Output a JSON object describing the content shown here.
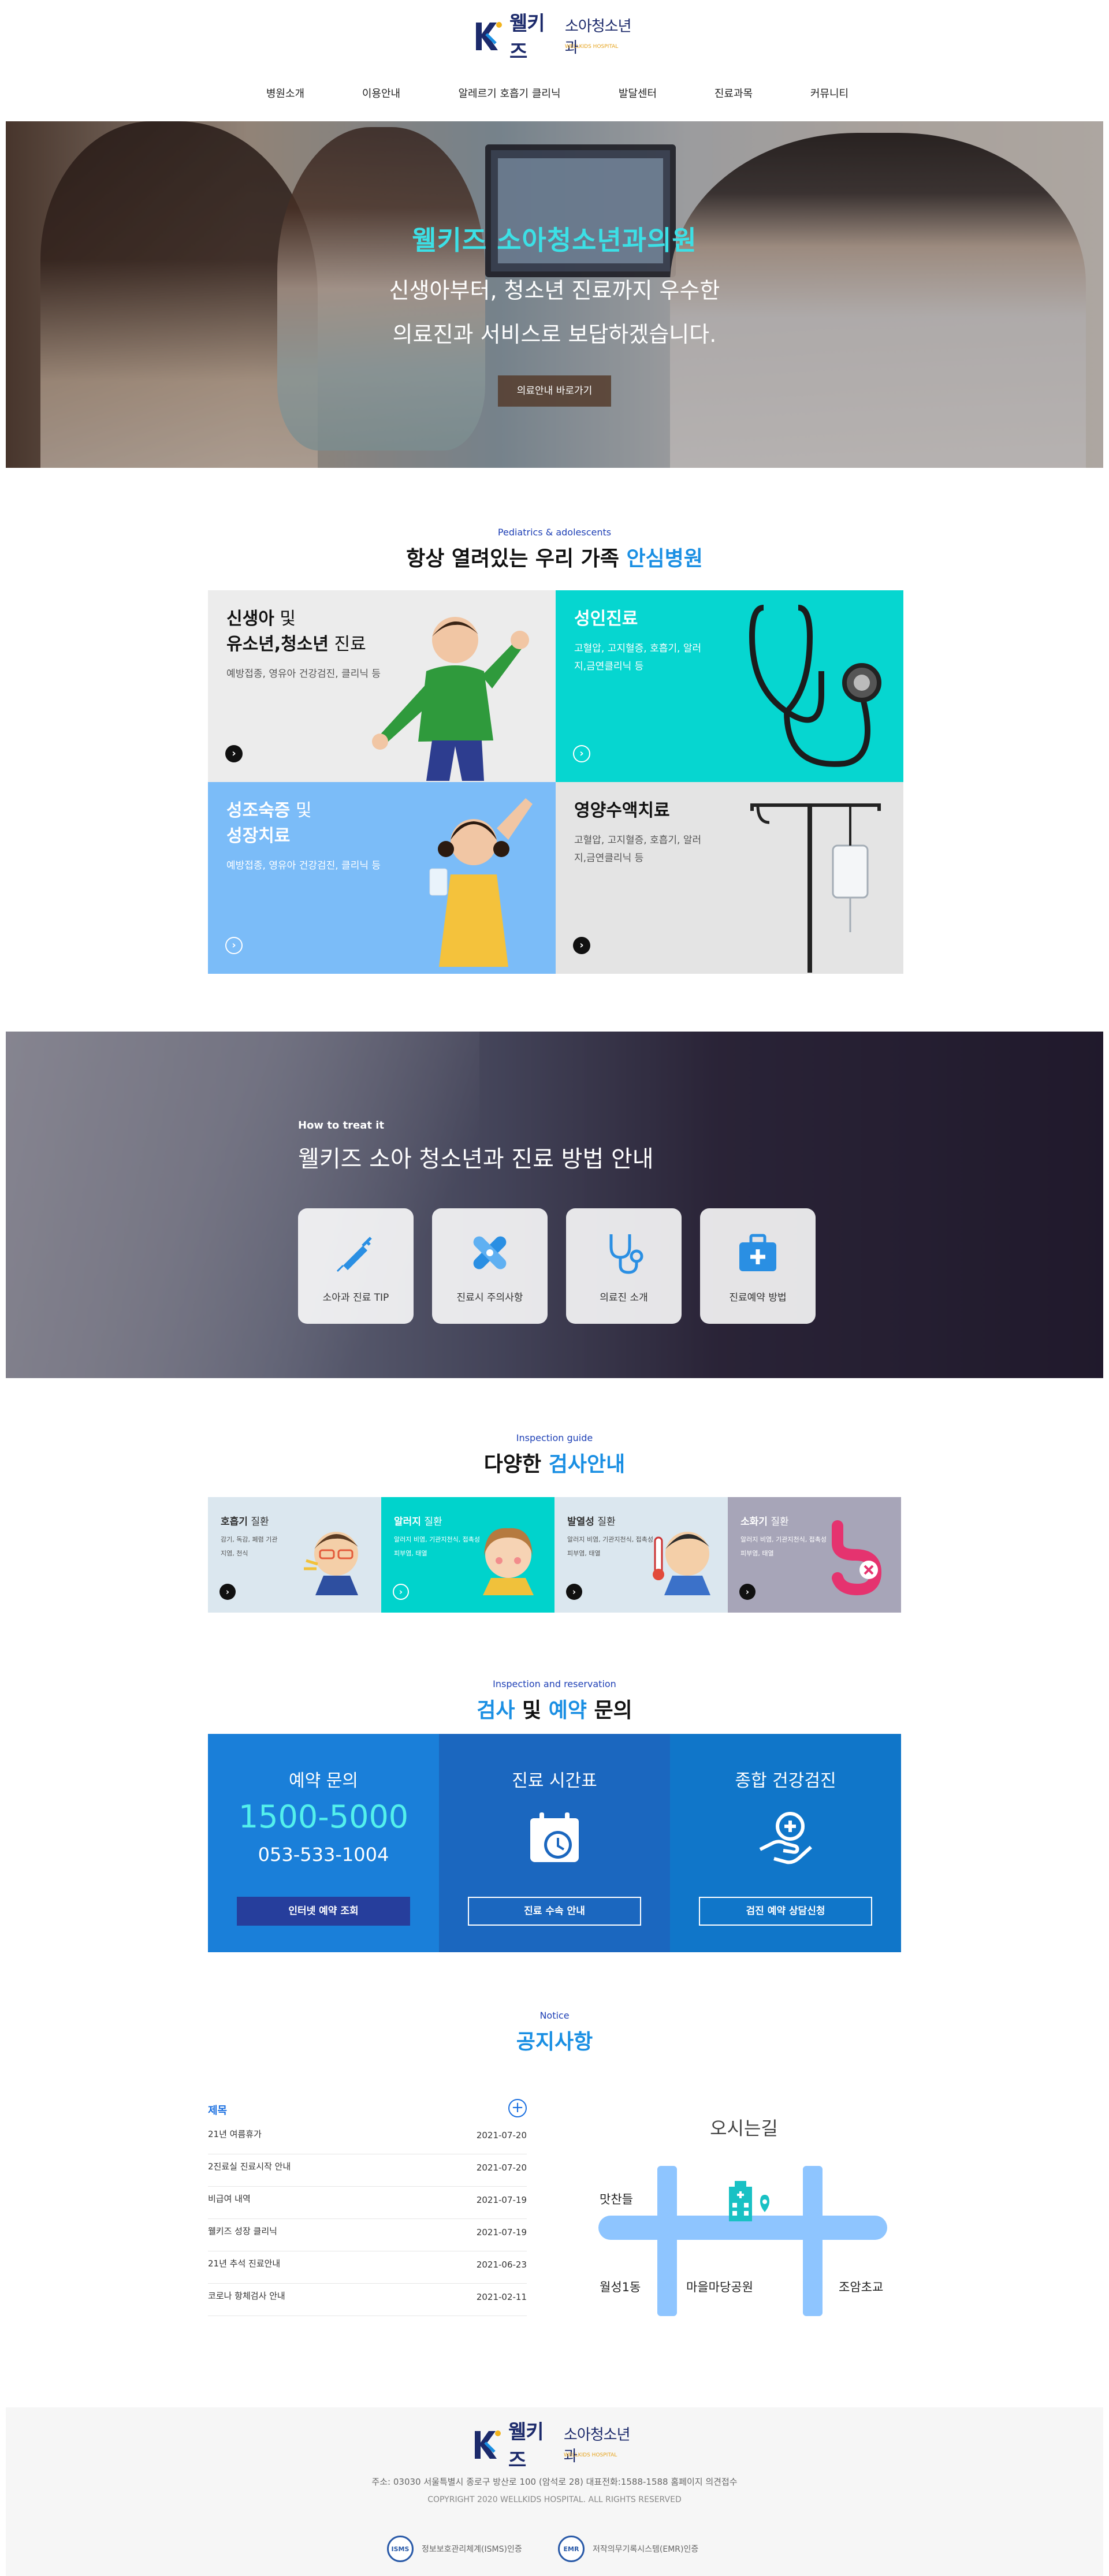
{
  "brand": {
    "name": "웰키즈",
    "subtitle": "소아청소년과",
    "tagline": "WELLKIDS HOSPITAL",
    "accent": "#1a8fe3",
    "navy": "#1c2a6b"
  },
  "nav": {
    "items": [
      {
        "label": "병원소개"
      },
      {
        "label": "이용안내"
      },
      {
        "label": "알레르기 호흡기 클리닉"
      },
      {
        "label": "발달센터"
      },
      {
        "label": "진료과목"
      },
      {
        "label": "커뮤니티"
      }
    ]
  },
  "hero": {
    "title": "웰키즈 소아청소년과의원",
    "line1": "신생아부터, 청소년 진료까지 우수한",
    "line2": "의료진과 서비스로 보답하겠습니다.",
    "button": "의료안내 바로가기"
  },
  "services_section": {
    "sub": "Pediatrics & adolescents",
    "title_main": "항상 열려있는 우리 가족",
    "title_hl": "안심병원"
  },
  "services": [
    {
      "title_a": "신생아",
      "title_b": " 및",
      "title_c": "유소년,청소년",
      "title_d": " 진료",
      "desc": "예방접종, 영유아 건강검진, 클리닉 등",
      "arrow": "›"
    },
    {
      "title_a": "성인진료",
      "desc": "고혈압, 고지혈증, 호흡기, 알러지,금연클리닉 등",
      "arrow": "›"
    },
    {
      "title_a": "성조숙증",
      "title_b": " 및",
      "title_c": "성장치료",
      "desc": "예방접종, 영유아 건강검진, 클리닉 등",
      "arrow": "›"
    },
    {
      "title_a": "영양수액치료",
      "desc": "고혈압, 고지혈증, 호흡기, 알러지,금연클리닉 등",
      "arrow": "›"
    }
  ],
  "howto": {
    "sub": "How to treat it",
    "title": "웰키즈 소아 청소년과 진료 방법 안내",
    "cards": [
      {
        "label": "소아과 진료 TIP",
        "icon": "syringe-icon"
      },
      {
        "label": "진료시 주의사항",
        "icon": "bandage-icon"
      },
      {
        "label": "의료진 소개",
        "icon": "stethoscope-icon"
      },
      {
        "label": "진료예약 방법",
        "icon": "medical-bag-icon"
      }
    ]
  },
  "inspection_section": {
    "sub": "Inspection guide",
    "title_main": "다양한",
    "title_hl": "검사안내"
  },
  "inspections": [
    {
      "title_a": "호흡기",
      "title_b": " 질환",
      "desc": "감기, 독감, 폐렴 기관지염, 천식",
      "arrow": "›"
    },
    {
      "title_a": "알러지",
      "title_b": " 질환",
      "desc": "알러지 비염, 기관지천식, 접촉성 피부염, 태열",
      "arrow": "›"
    },
    {
      "title_a": "발열성",
      "title_b": " 질환",
      "desc": "알러지 비염, 기관지천식, 접촉성 피부염, 태열",
      "arrow": "›"
    },
    {
      "title_a": "소화기",
      "title_b": " 질환",
      "desc": "알러지 비염, 기관지천식, 접촉성 피부염, 태열",
      "arrow": "›"
    }
  ],
  "reservation_section": {
    "sub": "Inspection and reservation",
    "title_hl1": "검사",
    "title_mid": " 및 ",
    "title_hl2": "예약",
    "title_end": " 문의"
  },
  "reservation": [
    {
      "title": "예약 문의",
      "phone": "1500-5000",
      "phone2": "053-533-1004",
      "button": "인터넷 예약 조회",
      "color": "#1a7fd9"
    },
    {
      "title": "진료 시간표",
      "button": "진료 수속 안내",
      "icon": "calendar-clock-icon",
      "color": "#1b67bf"
    },
    {
      "title": "종합 건강검진",
      "button": "검진 예약 상담신청",
      "icon": "health-hand-icon",
      "color": "#1076c9"
    }
  ],
  "notice_section": {
    "sub": "Notice",
    "title": "공지사항",
    "label": "제목",
    "plus": "+",
    "rows": [
      {
        "title": "21년 여름휴가",
        "date": "2021-07-20"
      },
      {
        "title": "2진료실 진료시작 안내",
        "date": "2021-07-20"
      },
      {
        "title": "비급여 내역",
        "date": "2021-07-19"
      },
      {
        "title": "웰키즈 성장 클리닉",
        "date": "2021-07-19"
      },
      {
        "title": "21년 추석 진료안내",
        "date": "2021-06-23"
      },
      {
        "title": "코로나 항체검사 안내",
        "date": "2021-02-11"
      }
    ]
  },
  "map": {
    "title": "오시는길",
    "labels": {
      "a": "맛찬들",
      "b": "월성1동",
      "c": "마을마당공원",
      "d": "조암초교"
    }
  },
  "footer": {
    "address": "주소: 03030 서울특별시 종로구 방산로 100 (암석로 28) 대표전화:1588-1588 홈페이지 의견접수",
    "copyright": "COPYRIGHT 2020 WELLKIDS HOSPITAL. ALL RIGHTS RESERVED",
    "cert1": "정보보호관리체계(ISMS)인증",
    "cert1_badge": "ISMS",
    "cert2": "저작의무기록시스템(EMR)인증",
    "cert2_badge": "EMR"
  }
}
